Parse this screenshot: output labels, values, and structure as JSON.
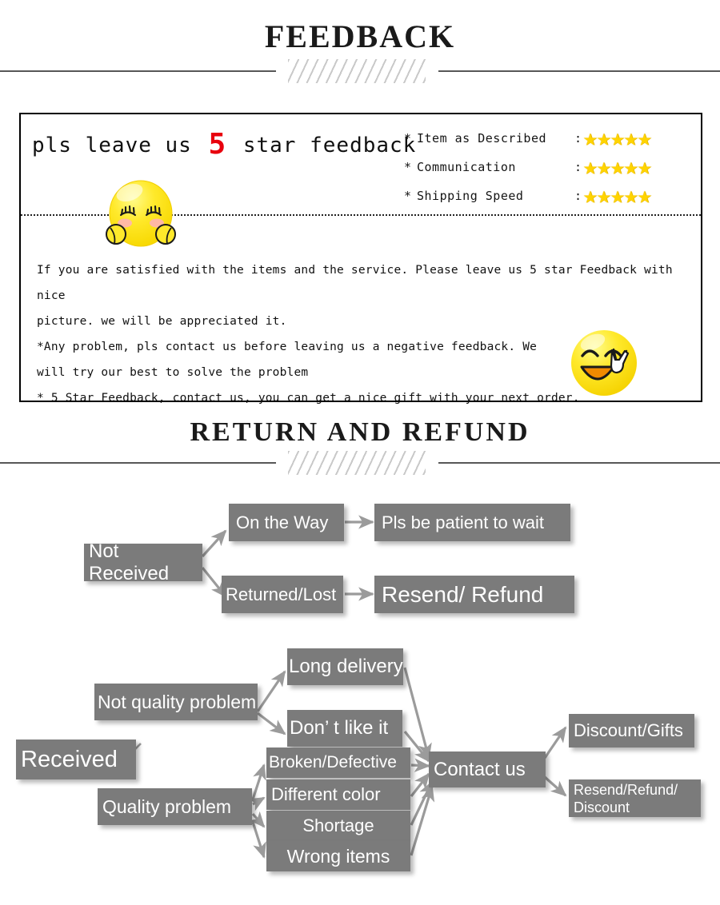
{
  "sections": {
    "feedback_title": "FEEDBACK",
    "return_title": "RETURN  AND  REFUND"
  },
  "feedback": {
    "headline_before": "pls  leave  us ",
    "headline_number": "5",
    "headline_after": " star  feedback",
    "ratings": [
      {
        "bullet": "*",
        "label": "Item as Described",
        "colon": ":",
        "stars": 5
      },
      {
        "bullet": "*",
        "label": "Communication",
        "colon": ":",
        "stars": 5
      },
      {
        "bullet": "*",
        "label": "Shipping Speed",
        "colon": ":",
        "stars": 5
      }
    ],
    "star_glyph": "★",
    "paragraph_lines": [
      "If you are satisfied with the items and the service. Please leave us 5 star Feedback with nice",
      "picture. we will be appreciated it.",
      "*Any problem, pls contact us before leaving us a negative feedback. We",
      "will try our best to solve  the problem",
      "* 5 Star Feedback, contact us, you can get a nice gift with your next order."
    ]
  },
  "flow": {
    "nodes": {
      "not_received": "Not Received",
      "on_the_way": "On the Way",
      "pls_be_patient": "Pls be patient to wait",
      "returned_lost": "Returned/Lost",
      "resend_refund": "Resend/ Refund",
      "received": "Received",
      "not_quality_problem": "Not quality problem",
      "quality_problem": "Quality problem",
      "long_delivery": "Long delivery",
      "dont_like_it": "Don’  t like it",
      "broken_defective": "Broken/Defective",
      "different_color": "Different color",
      "shortage": "Shortage",
      "wrong_items": "Wrong items",
      "contact_us": "Contact us",
      "discount_gifts": "Discount/Gifts",
      "resend_refund_discount": "Resend/Refund/\nDiscount"
    }
  },
  "colors": {
    "node_fill": "#7b7b7b",
    "node_text": "#ffffff",
    "arrow": "#9b9b9b",
    "star": "#ffd400",
    "accent_red": "#e8000d",
    "rule": "#575757"
  }
}
